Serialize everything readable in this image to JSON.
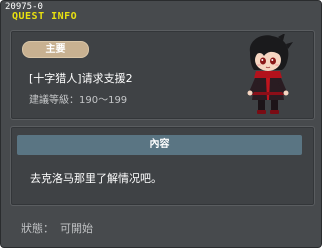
{
  "window": {
    "quest_id": "20975-0",
    "title": "QUEST INFO"
  },
  "quest": {
    "category_badge": "主要",
    "name": "[十字猎人]请求支援2",
    "level_range": "建議等級：190～199"
  },
  "content": {
    "header": "內容",
    "description": "去克洛马那里了解情况吧。"
  },
  "status": {
    "label": "狀態：",
    "value": "可開始"
  },
  "colors": {
    "title_yellow": "#e8e010",
    "badge_tan": "#c8b191",
    "header_teal": "#5a7583"
  }
}
